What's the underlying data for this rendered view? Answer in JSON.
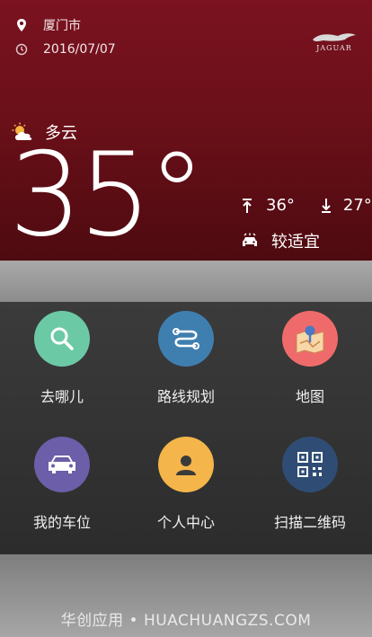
{
  "header": {
    "city": "厦门市",
    "date": "2016/07/07",
    "brand": "JAGUAR"
  },
  "weather": {
    "condition": "多云",
    "temperature": "35°",
    "high": "36°",
    "low": "27°",
    "comfort": "较适宜"
  },
  "tiles": [
    {
      "label": "去哪儿",
      "icon": "search-icon",
      "color": "#6cc9a6"
    },
    {
      "label": "路线规划",
      "icon": "route-icon",
      "color": "#3f7fb0"
    },
    {
      "label": "地图",
      "icon": "map-icon",
      "color": "#ef6b6b"
    },
    {
      "label": "我的车位",
      "icon": "car-icon",
      "color": "#6c5ea8"
    },
    {
      "label": "个人中心",
      "icon": "user-icon",
      "color": "#f4b54a"
    },
    {
      "label": "扫描二维码",
      "icon": "qrcode-icon",
      "color": "#2f4d74"
    }
  ],
  "footer": {
    "text": "华创应用 • HUACHUANGZS.COM"
  }
}
